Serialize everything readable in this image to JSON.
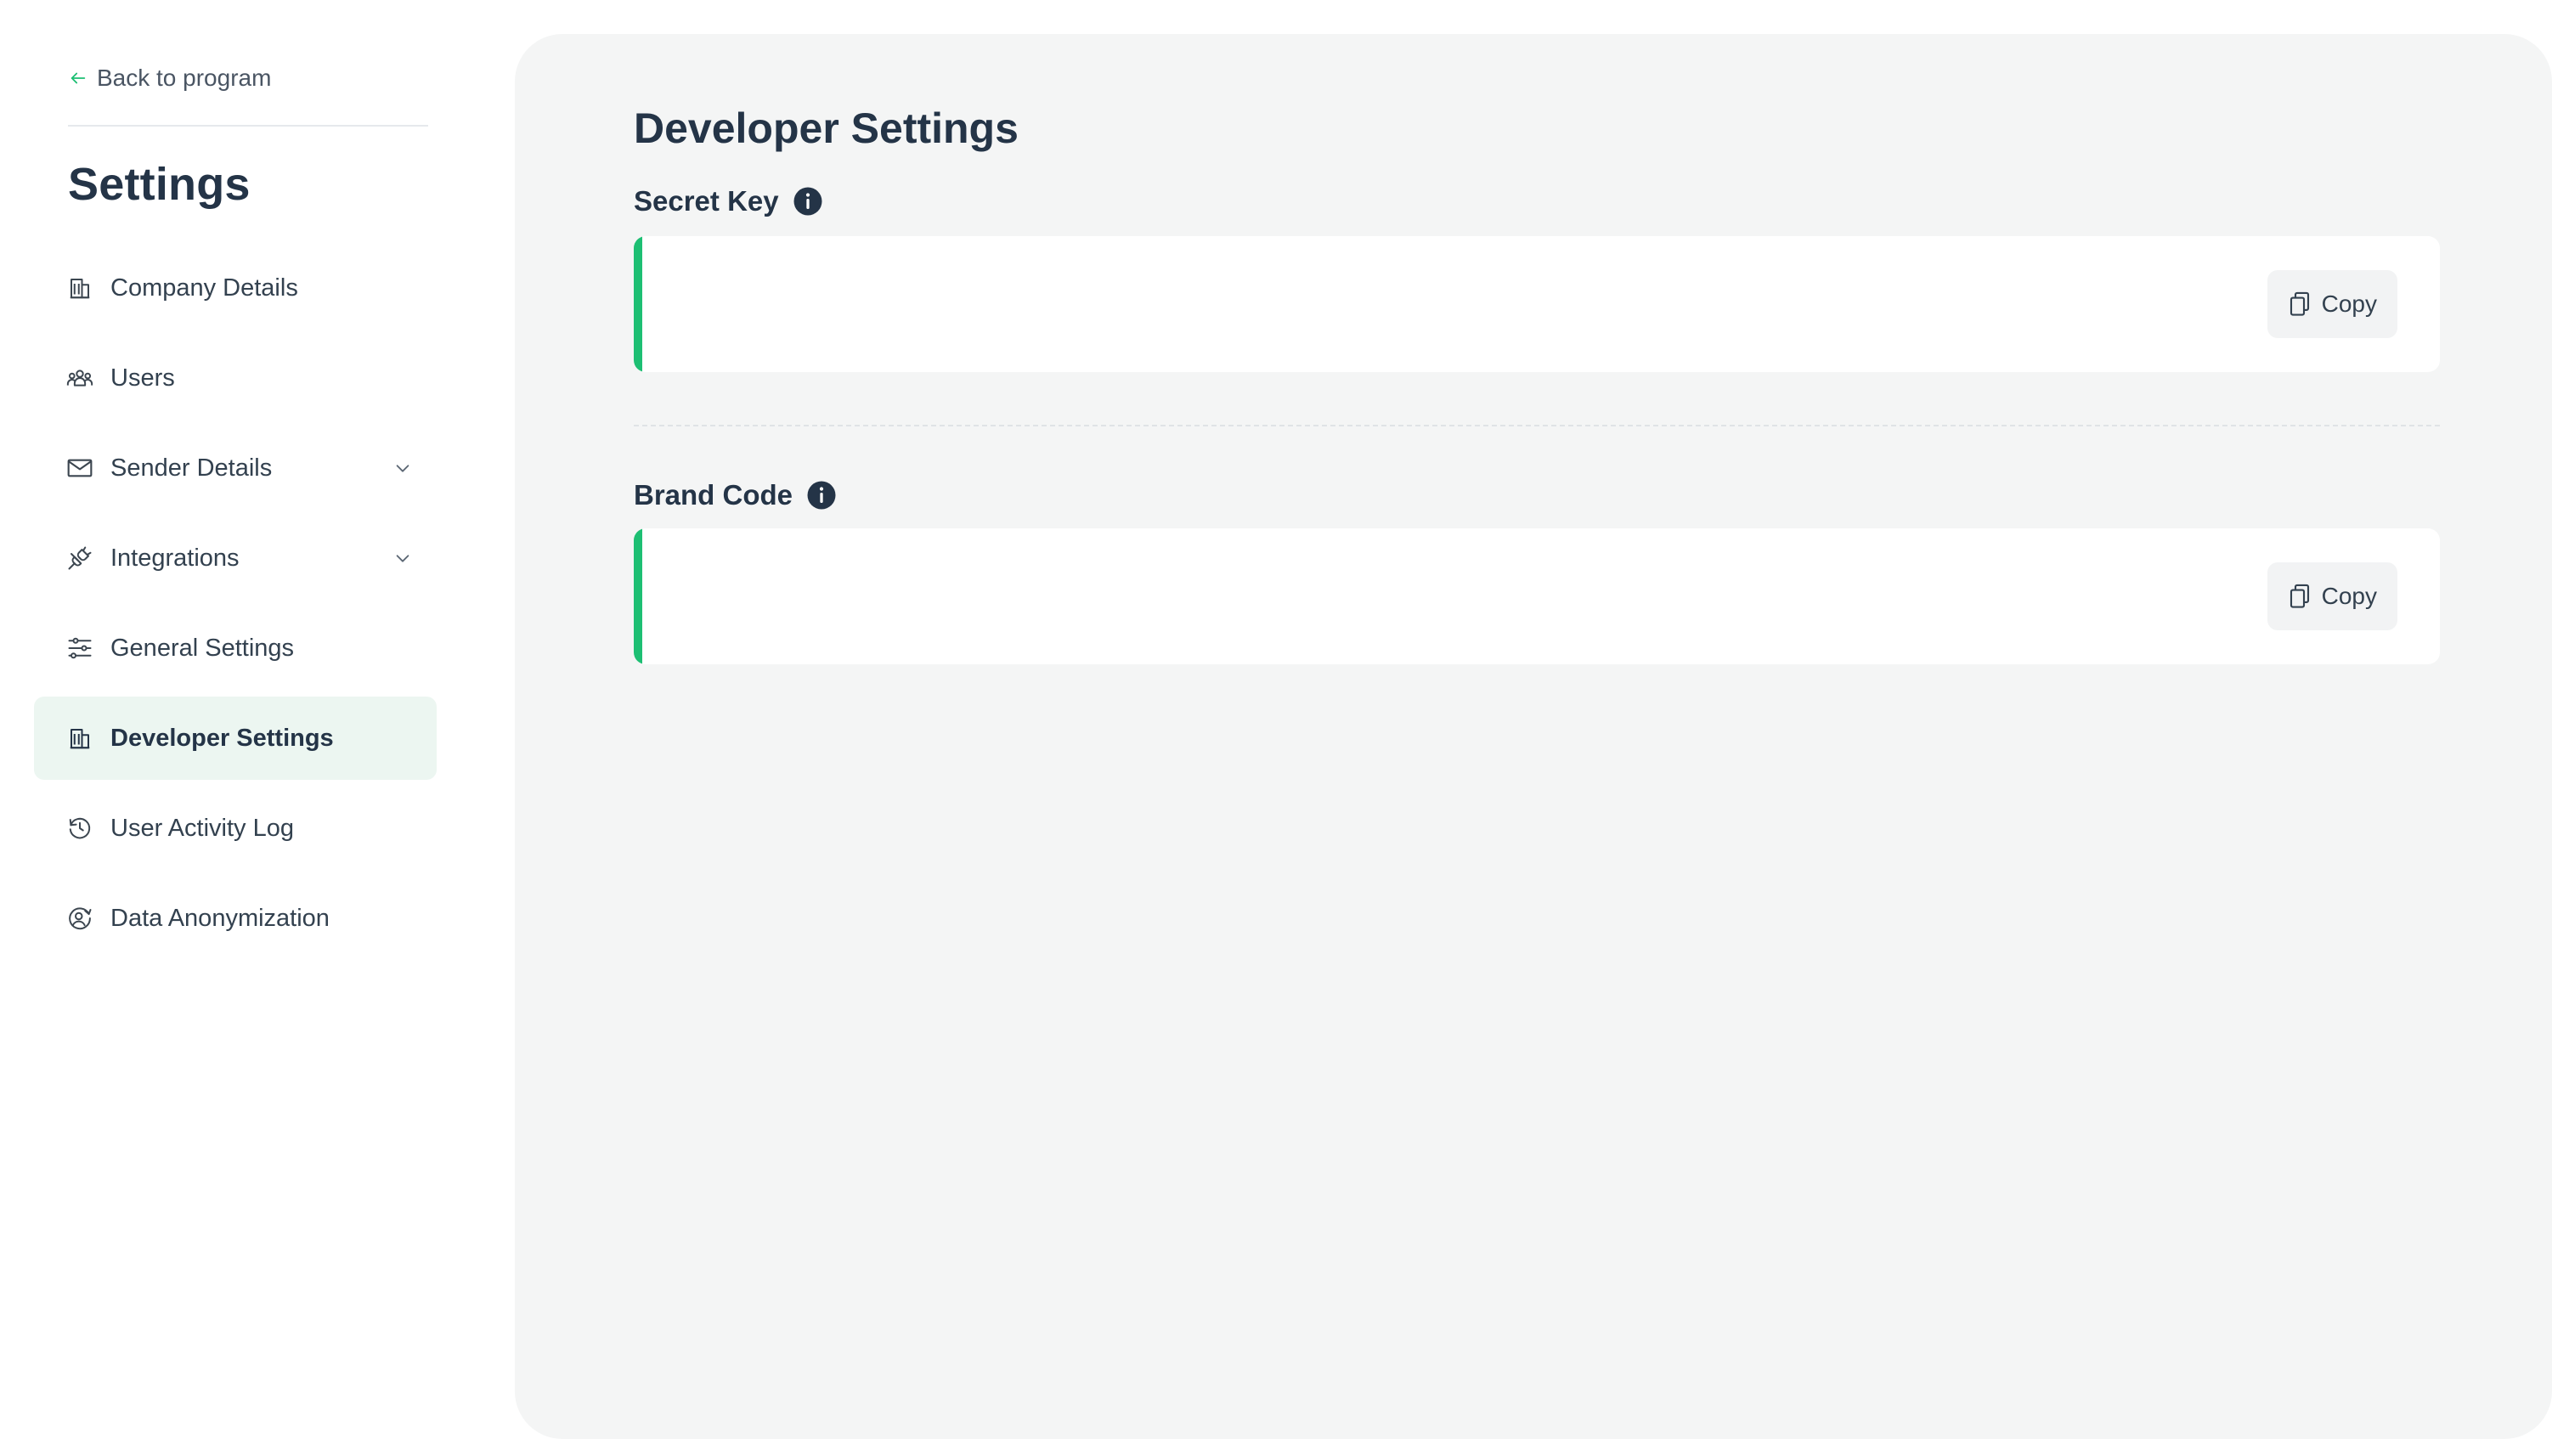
{
  "sidebar": {
    "back_label": "Back to program",
    "title": "Settings",
    "items": [
      {
        "label": "Company Details",
        "icon": "building-icon",
        "active": false,
        "expandable": false
      },
      {
        "label": "Users",
        "icon": "users-icon",
        "active": false,
        "expandable": false
      },
      {
        "label": "Sender Details",
        "icon": "envelope-icon",
        "active": false,
        "expandable": true
      },
      {
        "label": "Integrations",
        "icon": "plug-icon",
        "active": false,
        "expandable": true
      },
      {
        "label": "General Settings",
        "icon": "sliders-icon",
        "active": false,
        "expandable": false
      },
      {
        "label": "Developer Settings",
        "icon": "building-icon",
        "active": true,
        "expandable": false
      },
      {
        "label": "User Activity Log",
        "icon": "history-icon",
        "active": false,
        "expandable": false
      },
      {
        "label": "Data Anonymization",
        "icon": "user-shield-icon",
        "active": false,
        "expandable": false
      }
    ]
  },
  "main": {
    "title": "Developer Settings",
    "secret_key": {
      "label": "Secret Key",
      "value": "",
      "copy_label": "Copy"
    },
    "brand_code": {
      "label": "Brand Code",
      "value": "",
      "copy_label": "Copy"
    }
  },
  "colors": {
    "accent": "#1dbf73",
    "active_nav_bg": "#ecf6f1",
    "panel_bg": "#f4f5f5",
    "heading": "#243447"
  }
}
